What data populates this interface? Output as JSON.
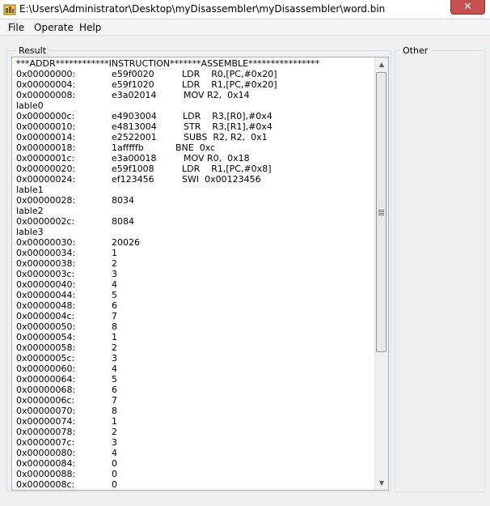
{
  "window": {
    "title": "E:\\Users\\Administrator\\Desktop\\myDisassembler\\myDisassembler\\word.bin",
    "close_glyph": "✕"
  },
  "menu": [
    "File",
    "Operate",
    "Help"
  ],
  "groups": {
    "result_label": "Result",
    "other_label": "Other"
  },
  "result": {
    "header": "***ADDR************INSTRUCTION*******ASSEMBLE****************",
    "rows": [
      {
        "addr": "0x00000000:",
        "hex": "e59f0020",
        "asm": "LDR    R0,[PC,#0x20]",
        "off": 205
      },
      {
        "addr": "0x00000004:",
        "hex": "e59f1020",
        "asm": "LDR    R1,[PC,#0x20]",
        "off": 205
      },
      {
        "addr": "0x00000008:",
        "hex": "e3a02014",
        "asm": "MOV R2,  0x14",
        "off": 207
      },
      {
        "addr": "lable0"
      },
      {
        "addr": "0x0000000c:",
        "hex": "e4903004",
        "asm": "LDR    R3,[R0],#0x4",
        "off": 206
      },
      {
        "addr": "0x00000010:",
        "hex": "e4813004",
        "asm": "STR    R3,[R1],#0x4",
        "off": 207
      },
      {
        "addr": "0x00000014:",
        "hex": "e2522001",
        "asm": "SUBS  R2, R2,  0x1",
        "off": 207
      },
      {
        "addr": "0x00000018:",
        "hex": "1afffffb",
        "asm": "BNE  0xc",
        "off": 197
      },
      {
        "addr": "0x0000001c:",
        "hex": "e3a00018",
        "asm": "MOV R0,  0x18",
        "off": 207
      },
      {
        "addr": "0x00000020:",
        "hex": "e59f1008",
        "asm": "LDR    R1,[PC,#0x8]",
        "off": 205
      },
      {
        "addr": "0x00000024:",
        "hex": "ef123456",
        "asm": "SWI  0x00123456",
        "off": 205
      },
      {
        "addr": "lable1"
      },
      {
        "addr": "0x00000028:",
        "hex": "8034"
      },
      {
        "addr": "lable2"
      },
      {
        "addr": "0x0000002c:",
        "hex": "8084"
      },
      {
        "addr": "lable3"
      },
      {
        "addr": "0x00000030:",
        "hex": "20026"
      },
      {
        "addr": "0x00000034:",
        "hex": "1"
      },
      {
        "addr": "0x00000038:",
        "hex": "2"
      },
      {
        "addr": "0x0000003c:",
        "hex": "3"
      },
      {
        "addr": "0x00000040:",
        "hex": "4"
      },
      {
        "addr": "0x00000044:",
        "hex": "5"
      },
      {
        "addr": "0x00000048:",
        "hex": "6"
      },
      {
        "addr": "0x0000004c:",
        "hex": "7"
      },
      {
        "addr": "0x00000050:",
        "hex": "8"
      },
      {
        "addr": "0x00000054:",
        "hex": "1"
      },
      {
        "addr": "0x00000058:",
        "hex": "2"
      },
      {
        "addr": "0x0000005c:",
        "hex": "3"
      },
      {
        "addr": "0x00000060:",
        "hex": "4"
      },
      {
        "addr": "0x00000064:",
        "hex": "5"
      },
      {
        "addr": "0x00000068:",
        "hex": "6"
      },
      {
        "addr": "0x0000006c:",
        "hex": "7"
      },
      {
        "addr": "0x00000070:",
        "hex": "8"
      },
      {
        "addr": "0x00000074:",
        "hex": "1"
      },
      {
        "addr": "0x00000078:",
        "hex": "2"
      },
      {
        "addr": "0x0000007c:",
        "hex": "3"
      },
      {
        "addr": "0x00000080:",
        "hex": "4"
      },
      {
        "addr": "0x00000084:",
        "hex": "0"
      },
      {
        "addr": "0x00000088:",
        "hex": "0"
      },
      {
        "addr": "0x0000008c:",
        "hex": "0"
      }
    ]
  },
  "scrollbar": {
    "up_glyph": "▲",
    "down_glyph": "▼"
  }
}
